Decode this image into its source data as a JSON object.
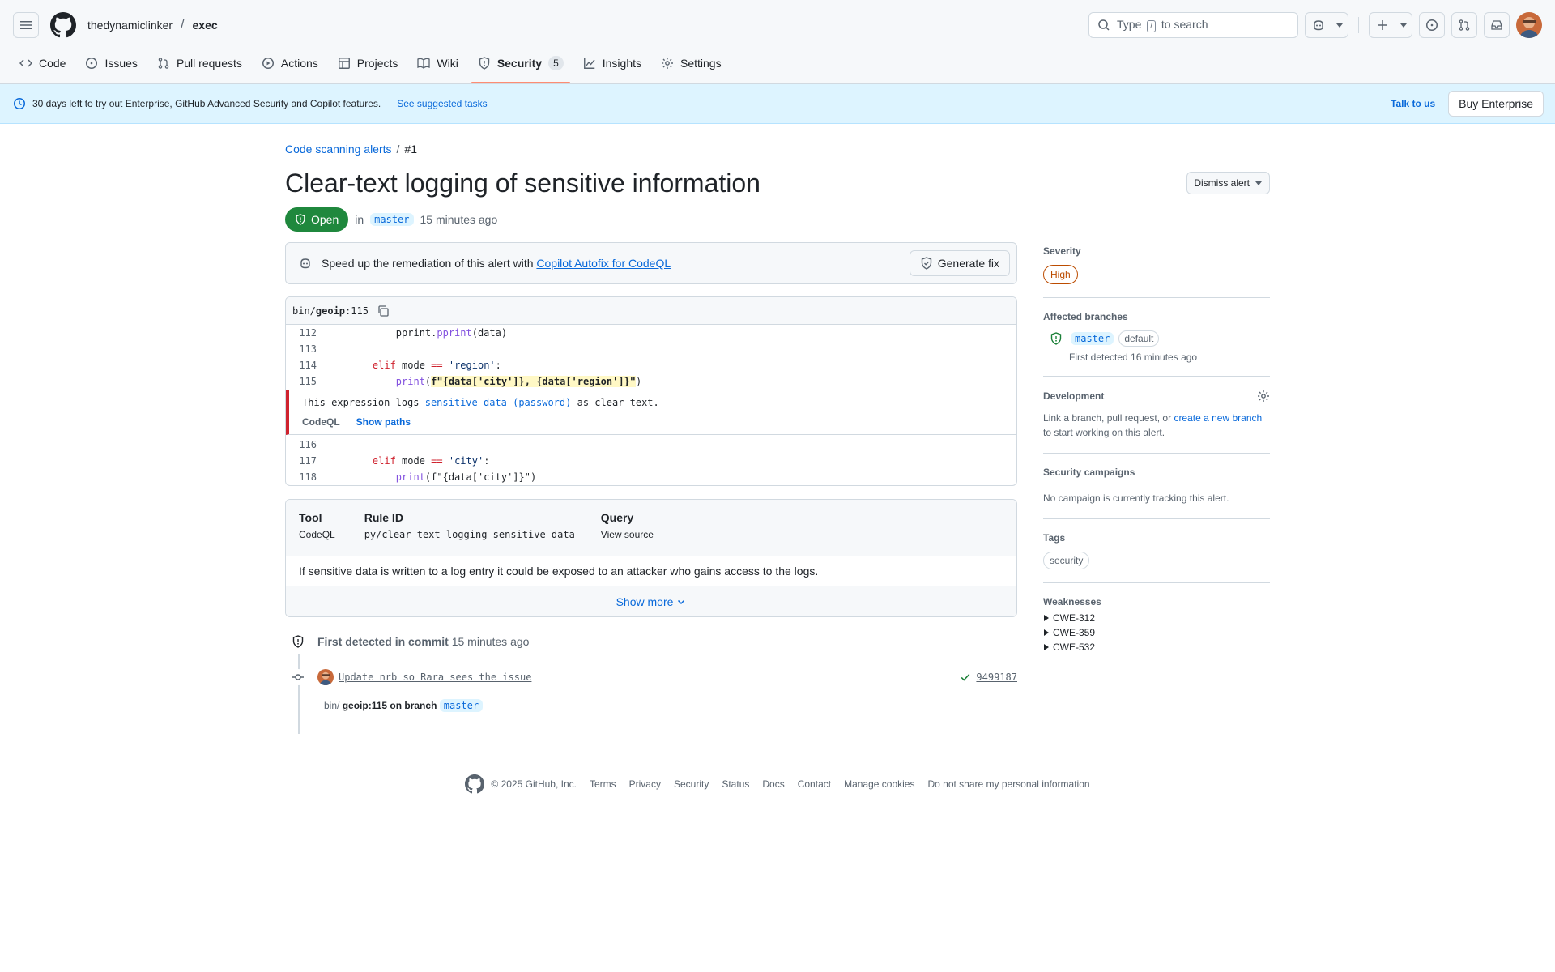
{
  "header": {
    "owner": "thedynamiclinker",
    "separator": "/",
    "repo": "exec",
    "search_placeholder_pre": "Type",
    "search_key": "/",
    "search_placeholder_post": "to search"
  },
  "tabs": [
    {
      "label": "Code",
      "icon": "code-icon"
    },
    {
      "label": "Issues",
      "icon": "issue-icon"
    },
    {
      "label": "Pull requests",
      "icon": "pull-request-icon"
    },
    {
      "label": "Actions",
      "icon": "play-icon"
    },
    {
      "label": "Projects",
      "icon": "table-icon"
    },
    {
      "label": "Wiki",
      "icon": "book-icon"
    },
    {
      "label": "Security",
      "icon": "shield-icon",
      "count": "5",
      "active": true
    },
    {
      "label": "Insights",
      "icon": "graph-icon"
    },
    {
      "label": "Settings",
      "icon": "gear-icon"
    }
  ],
  "banner": {
    "text": "30 days left to try out Enterprise, GitHub Advanced Security and Copilot features.",
    "link": "See suggested tasks",
    "talk": "Talk to us",
    "buy": "Buy Enterprise"
  },
  "alert": {
    "breadcrumb_link": "Code scanning alerts",
    "breadcrumb_sep": "/",
    "breadcrumb_num": "#1",
    "title": "Clear-text logging of sensitive information",
    "dismiss": "Dismiss alert",
    "state": "Open",
    "in": "in",
    "branch": "master",
    "time": "15 minutes ago"
  },
  "copilot": {
    "text": "Speed up the remediation of this alert with",
    "link": "Copilot Autofix for CodeQL",
    "button": "Generate fix"
  },
  "code": {
    "path_dir": "bin/",
    "path_file": "geoip",
    "path_line": ":115",
    "lines_before": [
      {
        "num": "112",
        "parts": [
          [
            "",
            "        pprint."
          ],
          [
            "fn",
            "pprint"
          ],
          [
            "",
            "(data)"
          ]
        ]
      },
      {
        "num": "113",
        "parts": [
          [
            "",
            ""
          ]
        ]
      },
      {
        "num": "114",
        "parts": [
          [
            "",
            "    "
          ],
          [
            "kw",
            "elif"
          ],
          [
            "",
            " mode "
          ],
          [
            "kw",
            "=="
          ],
          [
            "",
            " "
          ],
          [
            "str",
            "'region'"
          ],
          [
            "",
            ":"
          ]
        ]
      },
      {
        "num": "115",
        "parts": [
          [
            "",
            "        "
          ],
          [
            "fn",
            "print"
          ],
          [
            "",
            "("
          ],
          [
            "hl",
            "f\"{data['city']}, {data['region']}\""
          ],
          [
            "",
            ")"
          ]
        ]
      }
    ],
    "message_pre": "This expression logs",
    "message_link": "sensitive data (password)",
    "message_post": "as clear text.",
    "tool": "CodeQL",
    "show_paths": "Show paths",
    "lines_after": [
      {
        "num": "116",
        "parts": [
          [
            "",
            ""
          ]
        ]
      },
      {
        "num": "117",
        "parts": [
          [
            "",
            "    "
          ],
          [
            "kw",
            "elif"
          ],
          [
            "",
            " mode "
          ],
          [
            "kw",
            "=="
          ],
          [
            "",
            " "
          ],
          [
            "str",
            "'city'"
          ],
          [
            "",
            ":"
          ]
        ]
      },
      {
        "num": "118",
        "parts": [
          [
            "",
            "        "
          ],
          [
            "fn",
            "print"
          ],
          [
            "",
            "(f\"{data['city']}\")"
          ]
        ]
      }
    ]
  },
  "rule": {
    "tool_h": "Tool",
    "tool_v": "CodeQL",
    "rule_h": "Rule ID",
    "rule_v": "py/clear-text-logging-sensitive-data",
    "query_h": "Query",
    "query_v": "View source",
    "description": "If sensitive data is written to a log entry it could be exposed to an attacker who gains access to the logs.",
    "show_more": "Show more"
  },
  "timeline": {
    "first_detected": "First detected in commit",
    "first_time": "15 minutes ago",
    "commit_msg": "Update nrb so Rara sees the issue",
    "sha": "9499187",
    "path_dir": "bin/",
    "path_rest": "geoip:115 on branch",
    "branch": "master"
  },
  "sidebar": {
    "severity_h": "Severity",
    "severity": "High",
    "affected_h": "Affected branches",
    "affected_branch": "master",
    "affected_default": "default",
    "affected_detected": "First detected 16 minutes ago",
    "dev_h": "Development",
    "dev_text_pre": "Link a branch, pull request, or",
    "dev_link": "create a new branch",
    "dev_text_post": "to start working on this alert.",
    "campaigns_h": "Security campaigns",
    "campaigns_text": "No campaign is currently tracking this alert.",
    "tags_h": "Tags",
    "tag": "security",
    "weak_h": "Weaknesses",
    "weaknesses": [
      "CWE-312",
      "CWE-359",
      "CWE-532"
    ]
  },
  "footer": {
    "copyright": "© 2025 GitHub, Inc.",
    "links": [
      "Terms",
      "Privacy",
      "Security",
      "Status",
      "Docs",
      "Contact",
      "Manage cookies",
      "Do not share my personal information"
    ]
  }
}
